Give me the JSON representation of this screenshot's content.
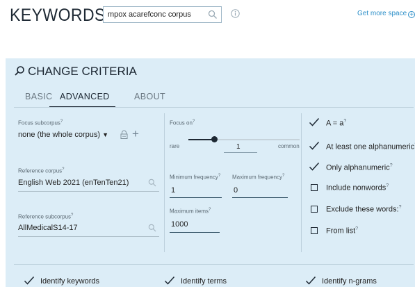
{
  "header": {
    "title": "KEYWORDS",
    "search_value": "mpox acarefconc corpus",
    "more_space_label": "Get more space"
  },
  "panel": {
    "title": "CHANGE CRITERIA",
    "tabs": [
      {
        "label": "BASIC",
        "active": false
      },
      {
        "label": "ADVANCED",
        "active": true
      },
      {
        "label": "ABOUT",
        "active": false
      }
    ],
    "left": {
      "focus_subcorpus_label": "Focus subcorpus",
      "focus_subcorpus_value": "none (the whole corpus)",
      "reference_corpus_label": "Reference corpus",
      "reference_corpus_value": "English Web 2021 (enTenTen21)",
      "reference_subcorpus_label": "Reference subcorpus",
      "reference_subcorpus_value": "AllMedicalS14-17"
    },
    "middle": {
      "focus_on_label": "Focus on",
      "rare_label": "rare",
      "common_label": "common",
      "focus_value": "1",
      "min_freq_label": "Minimum frequency",
      "min_freq_value": "1",
      "max_freq_label": "Maximum frequency",
      "max_freq_value": "0",
      "max_items_label": "Maximum items",
      "max_items_value": "1000"
    },
    "right": {
      "options": [
        {
          "label": "A = a",
          "checked": true,
          "help": true
        },
        {
          "label": "At least one alphanumeric",
          "checked": true,
          "help": true
        },
        {
          "label": "Only alphanumeric",
          "checked": true,
          "help": true
        },
        {
          "label": "Include nonwords",
          "checked": false,
          "help": true
        },
        {
          "label": "Exclude these words:",
          "checked": false,
          "help": true
        },
        {
          "label": "From list",
          "checked": false,
          "help": true
        }
      ]
    },
    "bottom": {
      "identify_keywords": "Identify keywords",
      "identify_terms": "Identify terms",
      "identify_ngrams": "Identify n-grams"
    },
    "help_mark": "?"
  },
  "colors": {
    "panel_bg": "#dcedf7",
    "accent": "#2a8ec8",
    "text_dark": "#1d2833"
  }
}
